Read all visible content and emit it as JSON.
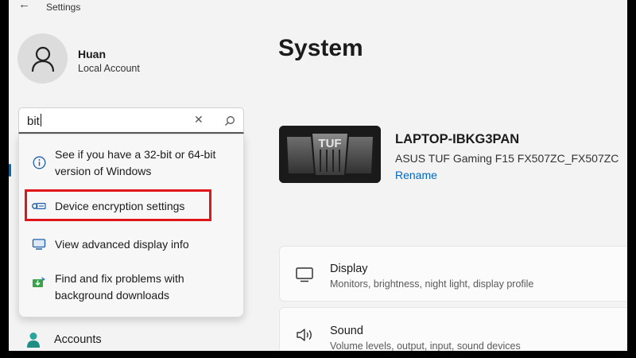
{
  "app": {
    "title": "Settings"
  },
  "user": {
    "name": "Huan",
    "account_type": "Local Account"
  },
  "search": {
    "query": "bit",
    "suggestions": [
      {
        "icon": "info-icon",
        "text": "See if you have a 32-bit or 64-bit version of Windows"
      },
      {
        "icon": "encryption-key-icon",
        "text": "Device encryption settings"
      },
      {
        "icon": "monitor-icon",
        "text": "View advanced display info"
      },
      {
        "icon": "download-troubleshoot-icon",
        "text": "Find and fix problems with background downloads"
      }
    ]
  },
  "sidebar": {
    "accounts_label": "Accounts"
  },
  "main": {
    "title": "System",
    "device": {
      "name": "LAPTOP-IBKG3PAN",
      "model": "ASUS TUF Gaming F15 FX507ZC_FX507ZC",
      "rename_label": "Rename",
      "image_logo_text": "TUF"
    },
    "cards": [
      {
        "icon": "display-icon",
        "title": "Display",
        "subtitle": "Monitors, brightness, night light, display profile"
      },
      {
        "icon": "sound-icon",
        "title": "Sound",
        "subtitle": "Volume levels, output, input, sound devices"
      }
    ]
  },
  "colors": {
    "accent": "#0067c0",
    "highlight": "#e0161b",
    "background": "#f3f3f3"
  }
}
